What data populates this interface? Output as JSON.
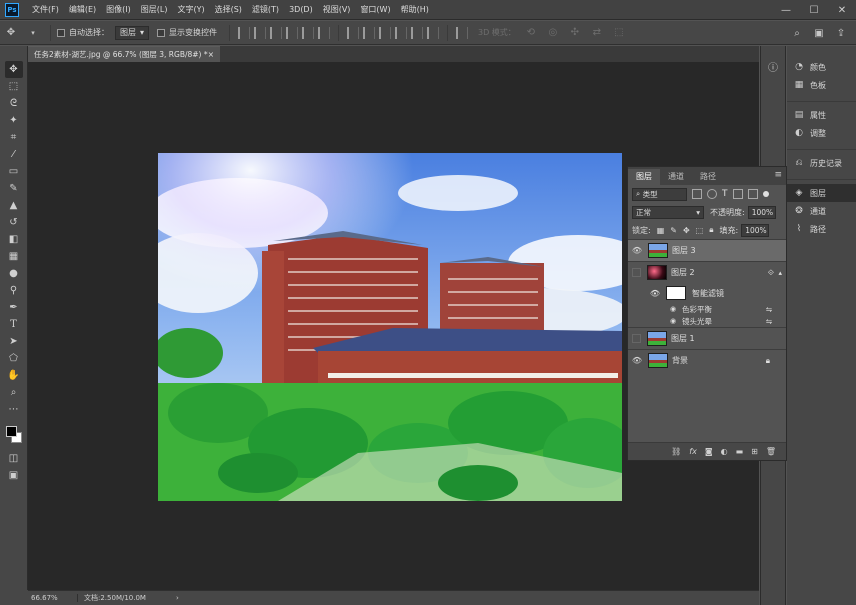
{
  "app": {
    "logo": "Ps",
    "menus": [
      "文件(F)",
      "编辑(E)",
      "图像(I)",
      "图层(L)",
      "文字(Y)",
      "选择(S)",
      "滤镜(T)",
      "3D(D)",
      "视图(V)",
      "窗口(W)",
      "帮助(H)"
    ]
  },
  "options": {
    "auto_select_label": "自动选择：",
    "auto_select_value": "图层",
    "show_transform_label": "显示变换控件",
    "mode_label": "3D 模式："
  },
  "document": {
    "tab_title": "任务2素材-湖艺.jpg @ 66.7% (图层 3, RGB/8#) *",
    "zoom": "66.67%",
    "doc_info": "文档:2.50M/10.0M"
  },
  "right_dock": {
    "items": [
      {
        "label": "颜色",
        "icon": "color-icon"
      },
      {
        "label": "色板",
        "icon": "swatches-icon"
      },
      {
        "label": "属性",
        "icon": "properties-icon"
      },
      {
        "label": "调整",
        "icon": "adjustments-icon"
      },
      {
        "label": "历史记录",
        "icon": "history-icon"
      },
      {
        "label": "图层",
        "icon": "layers-icon"
      },
      {
        "label": "通道",
        "icon": "channels-icon"
      },
      {
        "label": "路径",
        "icon": "paths-icon"
      }
    ]
  },
  "layers_panel": {
    "tabs": [
      "图层",
      "通道",
      "路径"
    ],
    "kind_label": "类型",
    "blend_mode": "正常",
    "opacity_label": "不透明度:",
    "opacity_value": "100%",
    "lock_label": "锁定:",
    "fill_label": "填充:",
    "fill_value": "100%",
    "layers": [
      {
        "name": "图层 3",
        "visible": true,
        "selected": true
      },
      {
        "name": "图层 2",
        "visible": false,
        "selected": false
      },
      {
        "name": "智能滤镜",
        "visible": true,
        "sub": true
      },
      {
        "name": "色彩平衡",
        "visible": true,
        "sub": true
      },
      {
        "name": "镜头光晕",
        "visible": true,
        "sub": true
      },
      {
        "name": "图层 1",
        "visible": false,
        "selected": false
      },
      {
        "name": "背景",
        "visible": true,
        "selected": false
      }
    ]
  }
}
